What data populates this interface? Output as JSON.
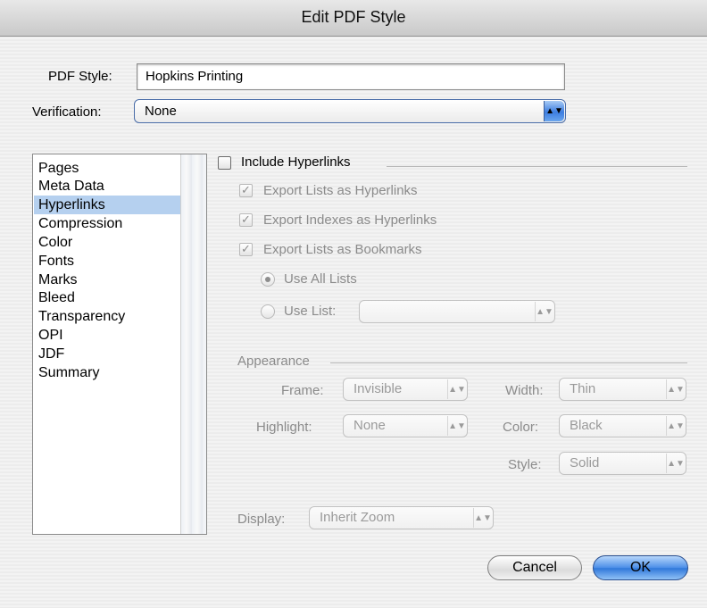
{
  "window": {
    "title": "Edit PDF Style"
  },
  "pdf_style": {
    "label": "PDF Style:",
    "value": "Hopkins Printing"
  },
  "verification": {
    "label": "Verification:",
    "value": "None"
  },
  "sidebar": {
    "items": [
      {
        "label": "Pages"
      },
      {
        "label": "Meta Data"
      },
      {
        "label": "Hyperlinks",
        "selected": true
      },
      {
        "label": "Compression"
      },
      {
        "label": "Color"
      },
      {
        "label": "Fonts"
      },
      {
        "label": "Marks"
      },
      {
        "label": "Bleed"
      },
      {
        "label": "Transparency"
      },
      {
        "label": "OPI"
      },
      {
        "label": "JDF"
      },
      {
        "label": "Summary"
      }
    ]
  },
  "hyperlinks": {
    "include_label": "Include Hyperlinks",
    "include_checked": false,
    "export_lists_label": "Export Lists as Hyperlinks",
    "export_indexes_label": "Export Indexes as Hyperlinks",
    "export_bookmarks_label": "Export Lists as Bookmarks",
    "checkmark": "✓",
    "use_all_lists_label": "Use All Lists",
    "use_list_label": "Use List:",
    "use_list_value": ""
  },
  "appearance": {
    "section_label": "Appearance",
    "frame_label": "Frame:",
    "frame_value": "Invisible",
    "width_label": "Width:",
    "width_value": "Thin",
    "highlight_label": "Highlight:",
    "highlight_value": "None",
    "color_label": "Color:",
    "color_value": "Black",
    "style_label": "Style:",
    "style_value": "Solid"
  },
  "display": {
    "label": "Display:",
    "value": "Inherit Zoom"
  },
  "buttons": {
    "cancel": "Cancel",
    "ok": "OK"
  },
  "icons": {
    "popup_arrows": "▲▼"
  },
  "colors": {
    "selection": "#b5d0ef",
    "accent": "#3c7de0",
    "disabled_text": "#8b8b8b"
  }
}
